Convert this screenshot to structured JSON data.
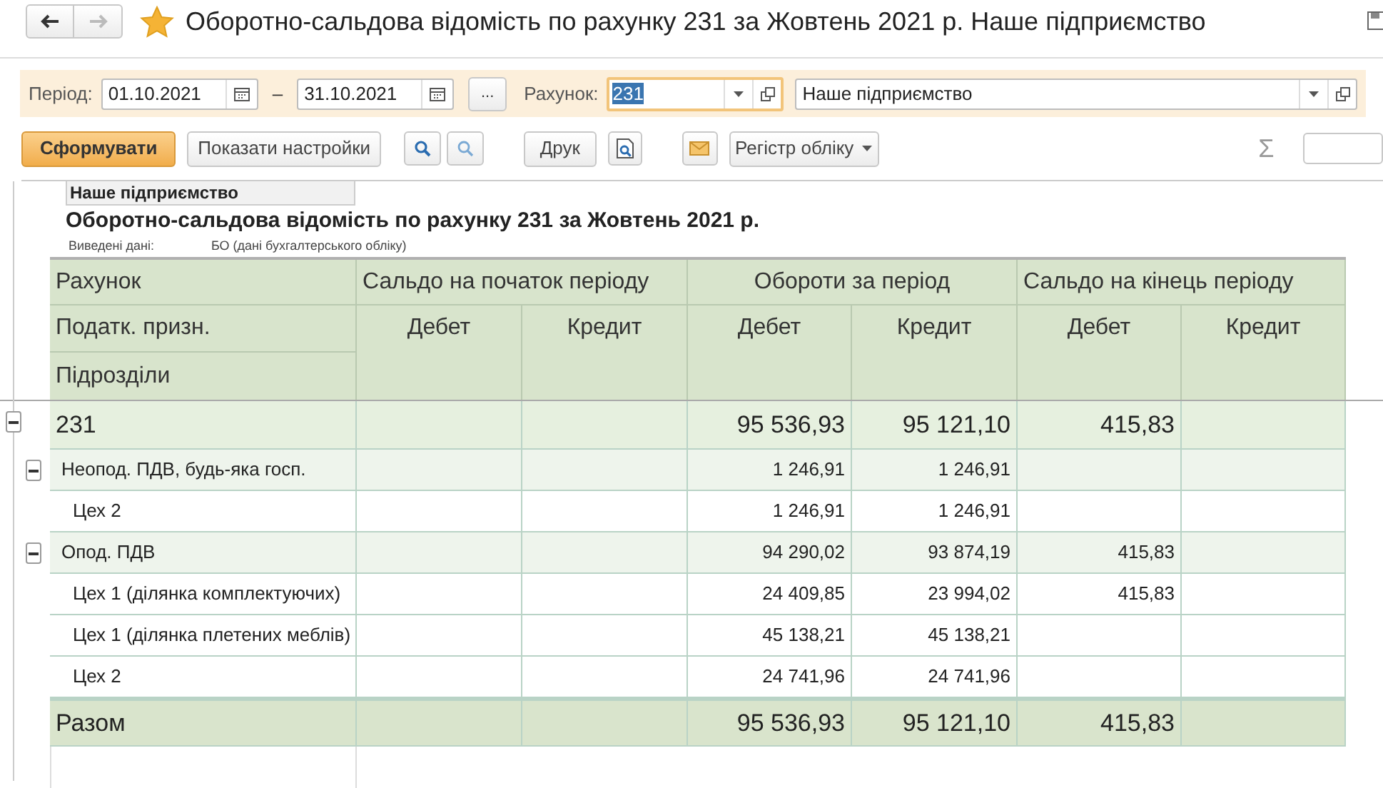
{
  "window": {
    "title": "Оборотно-сальдова відомість по рахунку 231 за Жовтень 2021 р. Наше підприємство",
    "back_disabled": false,
    "forward_disabled": true
  },
  "filters": {
    "period_label": "Період:",
    "date_from": "01.10.2021",
    "dash": "–",
    "date_to": "31.10.2021",
    "more": "...",
    "account_label": "Рахунок:",
    "account": "231",
    "organization": "Наше підприємство"
  },
  "toolbar": {
    "generate": "Сформувати",
    "settings": "Показати настройки",
    "print": "Друк",
    "register": "Регістр обліку",
    "sum": "Σ"
  },
  "report": {
    "organization": "Наше підприємство",
    "title": "Оборотно-сальдова відомість по рахунку 231 за Жовтень 2021 р.",
    "output_label": "Виведені дані:",
    "output_value": "БО (дані бухгалтерського обліку)",
    "header": {
      "row_labels": [
        "Рахунок",
        "Податк. призн.",
        "Підрозділи"
      ],
      "groups": [
        "Сальдо на початок періоду",
        "Обороти за період",
        "Сальдо на кінець періоду"
      ],
      "sub": [
        "Дебет",
        "Кредит",
        "Дебет",
        "Кредит",
        "Дебет",
        "Кредит"
      ]
    },
    "rows": [
      {
        "kind": "group",
        "label": "231",
        "turnover_debit": "95 536,93",
        "turnover_credit": "95 121,10",
        "closing_debit": "415,83",
        "expanded": true,
        "children": [
          {
            "kind": "subgroup",
            "label": "Неопод. ПДВ, будь-яка госп.",
            "turnover_debit": "1 246,91",
            "turnover_credit": "1 246,91",
            "expanded": true,
            "children": [
              {
                "kind": "item",
                "label": "Цех 2",
                "turnover_debit": "1 246,91",
                "turnover_credit": "1 246,91"
              }
            ]
          },
          {
            "kind": "subgroup",
            "label": "Опод. ПДВ",
            "turnover_debit": "94 290,02",
            "turnover_credit": "93 874,19",
            "closing_debit": "415,83",
            "expanded": true,
            "children": [
              {
                "kind": "item",
                "label": "Цех 1 (ділянка комплектуючих)",
                "turnover_debit": "24 409,85",
                "turnover_credit": "23 994,02",
                "closing_debit": "415,83"
              },
              {
                "kind": "item",
                "label": "Цех 1 (ділянка плетених меблів)",
                "turnover_debit": "45 138,21",
                "turnover_credit": "45 138,21"
              },
              {
                "kind": "item",
                "label": "Цех 2",
                "turnover_debit": "24 741,96",
                "turnover_credit": "24 741,96"
              }
            ]
          }
        ]
      },
      {
        "kind": "total",
        "label": "Разом",
        "turnover_debit": "95 536,93",
        "turnover_credit": "95 121,10",
        "closing_debit": "415,83"
      }
    ]
  }
}
